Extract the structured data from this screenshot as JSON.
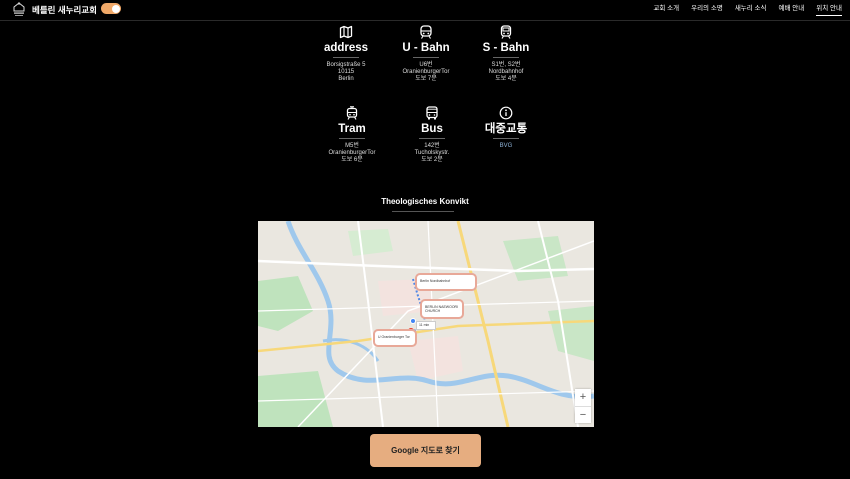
{
  "header": {
    "site_title": "베를린 새누리교회",
    "nav": [
      "교회 소개",
      "우리의 소명",
      "새누리 소식",
      "예배 안내",
      "위치 안내"
    ]
  },
  "info": [
    {
      "title": "address",
      "lines": [
        "Borsigstraße 5",
        "10115",
        "Berlin"
      ],
      "icon": "map-icon"
    },
    {
      "title": "U - Bahn",
      "lines": [
        "U6번",
        "OranienburgerTor",
        "도보 7분"
      ],
      "icon": "subway-icon"
    },
    {
      "title": "S - Bahn",
      "lines": [
        "S1번, S2번",
        "Nordbahnhof",
        "도보 4분"
      ],
      "icon": "train-icon"
    },
    {
      "title": "Tram",
      "lines": [
        "M5번",
        "OranienburgerTor",
        "도보 6분"
      ],
      "icon": "tram-icon"
    },
    {
      "title": "Bus",
      "lines": [
        "142번",
        "Tucholskystr.",
        "도보 2분"
      ],
      "icon": "bus-icon"
    },
    {
      "title": "대중교통",
      "lines": [
        "BVG"
      ],
      "icon": "info-icon"
    }
  ],
  "map": {
    "title": "Theologisches Konvikt",
    "labels": [
      "Berlin Nordbahnhof",
      "BERLIN NAEWOORI CHURCH",
      "11 min",
      "U Oranienburger Tor"
    ]
  },
  "google_button": "Google 지도로 찾기",
  "colors": {
    "accent": "#e6ad80",
    "toggle": "#f0a868",
    "background": "#000000"
  }
}
